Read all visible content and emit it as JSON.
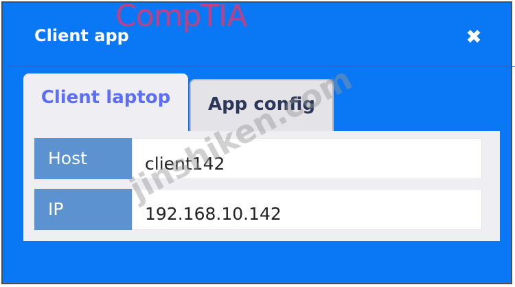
{
  "logo_text": "CompTIA",
  "dialog": {
    "title": "Client app",
    "close_glyph": "✖"
  },
  "tabs": [
    {
      "label": "Client laptop",
      "active": true
    },
    {
      "label": "App config",
      "active": false
    }
  ],
  "fields": [
    {
      "label": "Host",
      "value": "client142"
    },
    {
      "label": "IP",
      "value": "192.168.10.142"
    }
  ],
  "watermark": "jinshiken.com",
  "colors": {
    "dialog_bg": "#0a78f5",
    "label_bg": "#5b92cf",
    "active_tab_text": "#5b6ef5",
    "logo": "#e1376f"
  }
}
